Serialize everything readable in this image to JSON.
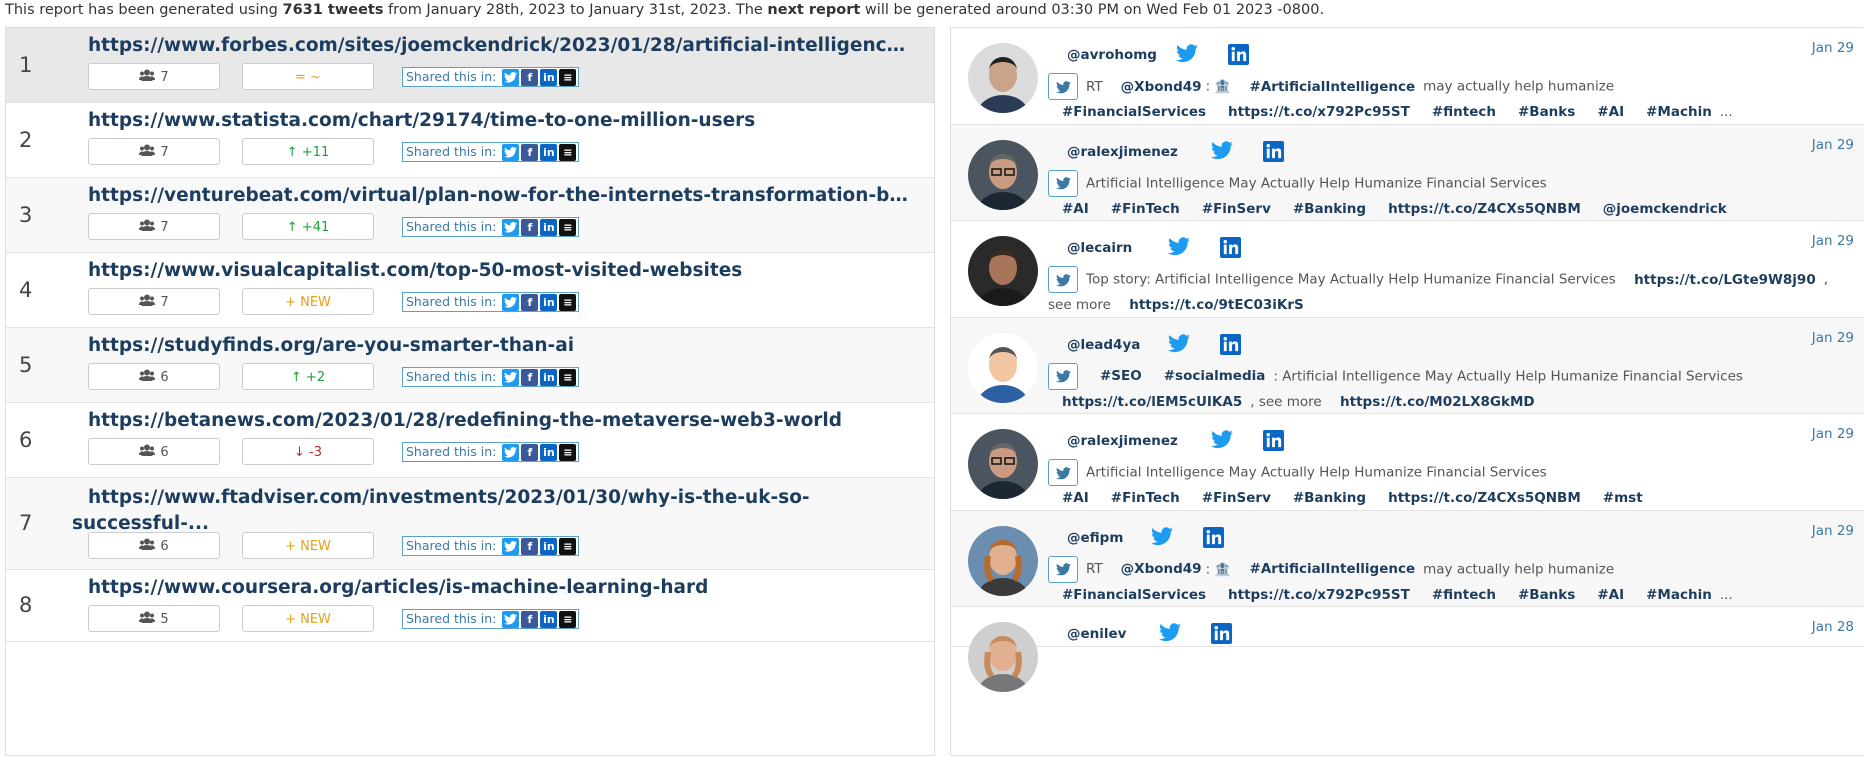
{
  "banner": {
    "part1": "This report has been generated using ",
    "tweets": "7631 tweets",
    "part2": " from January 28th, 2023 to January 31st, 2023. The ",
    "next": "next report",
    "part3": " will be generated around 03:30 PM on Wed Feb 01 2023 -0800."
  },
  "shared_label": "Shared this in:",
  "rows": [
    {
      "rank": "1",
      "url": "https://www.forbes.com/sites/joemckendrick/2023/01/28/artificial-intelligence...",
      "users": "7",
      "trend": "= ~",
      "trend_kind": "same"
    },
    {
      "rank": "2",
      "url": "https://www.statista.com/chart/29174/time-to-one-million-users",
      "users": "7",
      "trend": "+11",
      "trend_kind": "up"
    },
    {
      "rank": "3",
      "url": "https://venturebeat.com/virtual/plan-now-for-the-internets-transformation-by-...",
      "users": "7",
      "trend": "+41",
      "trend_kind": "up"
    },
    {
      "rank": "4",
      "url": "https://www.visualcapitalist.com/top-50-most-visited-websites",
      "users": "7",
      "trend": "NEW",
      "trend_kind": "new"
    },
    {
      "rank": "5",
      "url": "https://studyfinds.org/are-you-smarter-than-ai",
      "users": "6",
      "trend": "+2",
      "trend_kind": "up"
    },
    {
      "rank": "6",
      "url": "https://betanews.com/2023/01/28/redefining-the-metaverse-web3-world",
      "users": "6",
      "trend": "-3",
      "trend_kind": "down"
    },
    {
      "rank": "7",
      "url": "https://www.ftadviser.com/investments/2023/01/30/why-is-the-uk-so-successful-...",
      "users": "6",
      "trend": "NEW",
      "trend_kind": "new"
    },
    {
      "rank": "8",
      "url": "https://www.coursera.org/articles/is-machine-learning-hard",
      "users": "5",
      "trend": "NEW",
      "trend_kind": "new"
    }
  ],
  "tweets": [
    {
      "handle": "@avrohomg",
      "date": "Jan 29",
      "avatar": "man-suit",
      "parts": [
        [
          "rt",
          "RT"
        ],
        [
          "mention",
          "@Xbond49"
        ],
        [
          "text",
          ": 🏦"
        ],
        [
          "tag",
          "#ArtificialIntelligence"
        ],
        [
          "text",
          "may actually help humanize"
        ],
        [
          "tag",
          "#FinancialServices"
        ],
        [
          "link",
          "https://t.co/x792Pc95ST"
        ],
        [
          "tag",
          "#fintech"
        ],
        [
          "tag",
          "#Banks"
        ],
        [
          "tag",
          "#AI"
        ],
        [
          "tag",
          "#Machin"
        ],
        [
          "text",
          "..."
        ]
      ]
    },
    {
      "handle": "@ralexjimenez",
      "date": "Jan 29",
      "avatar": "man-glasses",
      "parts": [
        [
          "text",
          "Artificial Intelligence May Actually Help Humanize Financial Services"
        ],
        [
          "tag",
          "#AI"
        ],
        [
          "tag",
          "#FinTech"
        ],
        [
          "tag",
          "#FinServ"
        ],
        [
          "tag",
          "#Banking"
        ],
        [
          "link",
          "https://t.co/Z4CXs5QNBM"
        ],
        [
          "mention",
          "@joemckendrick"
        ]
      ]
    },
    {
      "handle": "@lecairn",
      "date": "Jan 29",
      "avatar": "man-dark",
      "parts": [
        [
          "text",
          "Top story: Artificial Intelligence May Actually Help Humanize Financial Services"
        ],
        [
          "link",
          "https://t.co/LGte9W8j90"
        ],
        [
          "text",
          ", see more"
        ],
        [
          "link",
          "https://t.co/9tEC03iKrS"
        ]
      ]
    },
    {
      "handle": "@lead4ya",
      "date": "Jan 29",
      "avatar": "cartoon",
      "parts": [
        [
          "tag",
          "#SEO"
        ],
        [
          "tag",
          "#socialmedia"
        ],
        [
          "text",
          ": Artificial Intelligence May Actually Help Humanize Financial Services"
        ],
        [
          "link",
          "https://t.co/lEM5cUIKA5"
        ],
        [
          "text",
          ", see more"
        ],
        [
          "link",
          "https://t.co/M02LX8GkMD"
        ]
      ]
    },
    {
      "handle": "@ralexjimenez",
      "date": "Jan 29",
      "avatar": "man-glasses",
      "parts": [
        [
          "text",
          "Artificial Intelligence May Actually Help Humanize Financial Services"
        ],
        [
          "tag",
          "#AI"
        ],
        [
          "tag",
          "#FinTech"
        ],
        [
          "tag",
          "#FinServ"
        ],
        [
          "tag",
          "#Banking"
        ],
        [
          "link",
          "https://t.co/Z4CXs5QNBM"
        ],
        [
          "tag",
          "#mst"
        ]
      ]
    },
    {
      "handle": "@efipm",
      "date": "Jan 29",
      "avatar": "woman",
      "parts": [
        [
          "rt",
          "RT"
        ],
        [
          "mention",
          "@Xbond49"
        ],
        [
          "text",
          ": 🏦"
        ],
        [
          "tag",
          "#ArtificialIntelligence"
        ],
        [
          "text",
          "may actually help humanize"
        ],
        [
          "tag",
          "#FinancialServices"
        ],
        [
          "link",
          "https://t.co/x792Pc95ST"
        ],
        [
          "tag",
          "#fintech"
        ],
        [
          "tag",
          "#Banks"
        ],
        [
          "tag",
          "#AI"
        ],
        [
          "tag",
          "#Machin"
        ],
        [
          "text",
          "..."
        ]
      ]
    },
    {
      "handle": "@enilev",
      "date": "Jan 28",
      "avatar": "woman2",
      "parts": []
    }
  ]
}
